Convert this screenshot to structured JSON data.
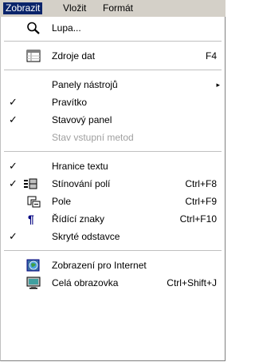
{
  "menubar": {
    "items": [
      "Zobrazit",
      "Vložit",
      "Formát"
    ]
  },
  "menu": {
    "lupa": "Lupa...",
    "zdroje_dat": "Zdroje dat",
    "zdroje_dat_shortcut": "F4",
    "panely": "Panely nástrojů",
    "pravitko": "Pravítko",
    "stavovy_panel": "Stavový panel",
    "stav_vstupni": "Stav vstupní metod",
    "hranice_textu": "Hranice textu",
    "stinovani_poli": "Stínování polí",
    "stinovani_shortcut": "Ctrl+F8",
    "pole": "Pole",
    "pole_shortcut": "Ctrl+F9",
    "ridici_znaky": "Řídící znaky",
    "ridici_shortcut": "Ctrl+F10",
    "skryte_odstavce": "Skryté odstavce",
    "zobrazeni_internet": "Zobrazení pro Internet",
    "cela_obrazovka": "Celá obrazovka",
    "cela_shortcut": "Ctrl+Shift+J",
    "check_mark": "✓",
    "submenu_arrow": "▸"
  },
  "icons": {
    "lupa": "magnifier-icon",
    "zdroje": "data-sources-icon",
    "stinovani": "field-shading-icon",
    "pole": "fields-icon",
    "ridici": "pilcrow-icon",
    "internet": "internet-view-icon",
    "cela": "fullscreen-icon"
  },
  "colors": {
    "menubar_bg": "#d4d0c8",
    "highlight": "#0a246a",
    "disabled_text": "#a0a0a0"
  }
}
